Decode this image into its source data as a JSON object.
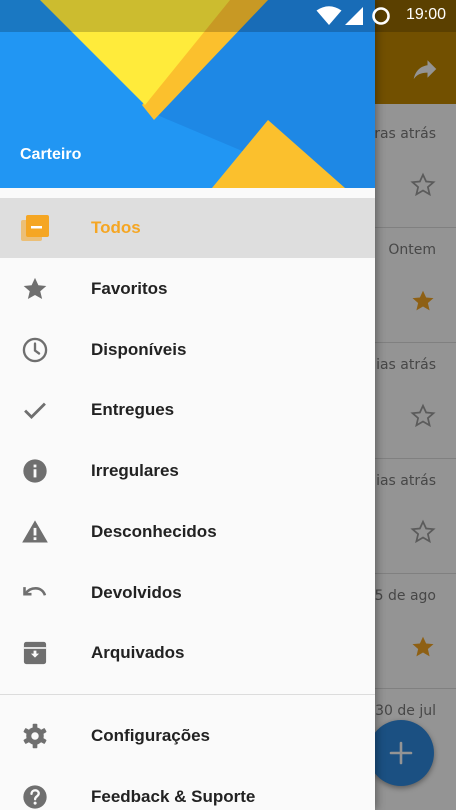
{
  "status_bar": {
    "time": "19:00",
    "icons": [
      "wifi-icon",
      "signal-icon",
      "sync-icon"
    ]
  },
  "background": {
    "toolbar_icon": "share-icon",
    "items": [
      {
        "time": "oras atrás",
        "starred": false
      },
      {
        "time": "Ontem",
        "starred": true
      },
      {
        "time": "dias atrás",
        "starred": false
      },
      {
        "time": "dias atrás",
        "starred": false
      },
      {
        "time": "5 de ago",
        "starred": true
      },
      {
        "time": "30 de jul",
        "starred": false
      }
    ],
    "fab_icon": "plus-icon"
  },
  "drawer": {
    "header_title": "Carteiro",
    "nav_items": [
      {
        "label": "Todos",
        "icon": "all-packages-icon",
        "active": true
      },
      {
        "label": "Favoritos",
        "icon": "star-icon",
        "active": false
      },
      {
        "label": "Disponíveis",
        "icon": "clock-icon",
        "active": false
      },
      {
        "label": "Entregues",
        "icon": "check-icon",
        "active": false
      },
      {
        "label": "Irregulares",
        "icon": "info-icon",
        "active": false
      },
      {
        "label": "Desconhecidos",
        "icon": "warning-icon",
        "active": false
      },
      {
        "label": "Devolvidos",
        "icon": "undo-icon",
        "active": false
      },
      {
        "label": "Arquivados",
        "icon": "archive-icon",
        "active": false
      }
    ],
    "secondary_items": [
      {
        "label": "Configurações",
        "icon": "gear-icon"
      },
      {
        "label": "Feedback & Suporte",
        "icon": "help-icon"
      }
    ]
  },
  "colors": {
    "accent": "#f5a623",
    "header_blue": "#2196f3",
    "fab": "#2f8be0",
    "toolbar": "#c48a00"
  }
}
